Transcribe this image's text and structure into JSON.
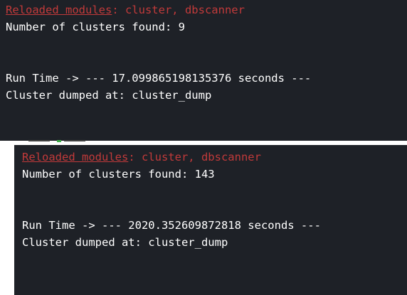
{
  "top_console": {
    "reload_prefix": "Reloaded modules",
    "reload_suffix": ": cluster, dbscanner",
    "clusters_line": "Number of clusters found: 9",
    "runtime_line": "Run Time -> --- 17.099865198135376 seconds ---",
    "dump_line": "Cluster dumped at: cluster_dump"
  },
  "bottom_console": {
    "reload_prefix": "Reloaded modules",
    "reload_suffix": ": cluster, dbscanner",
    "clusters_line": "Number of clusters found: 143",
    "runtime_line": "Run Time -> --- 2020.352609872818 seconds ---",
    "dump_line": "Cluster dumped at: cluster_dump"
  },
  "colors": {
    "background": "#1e2127",
    "text": "#ffffff",
    "error_red": "#c23a3a"
  }
}
